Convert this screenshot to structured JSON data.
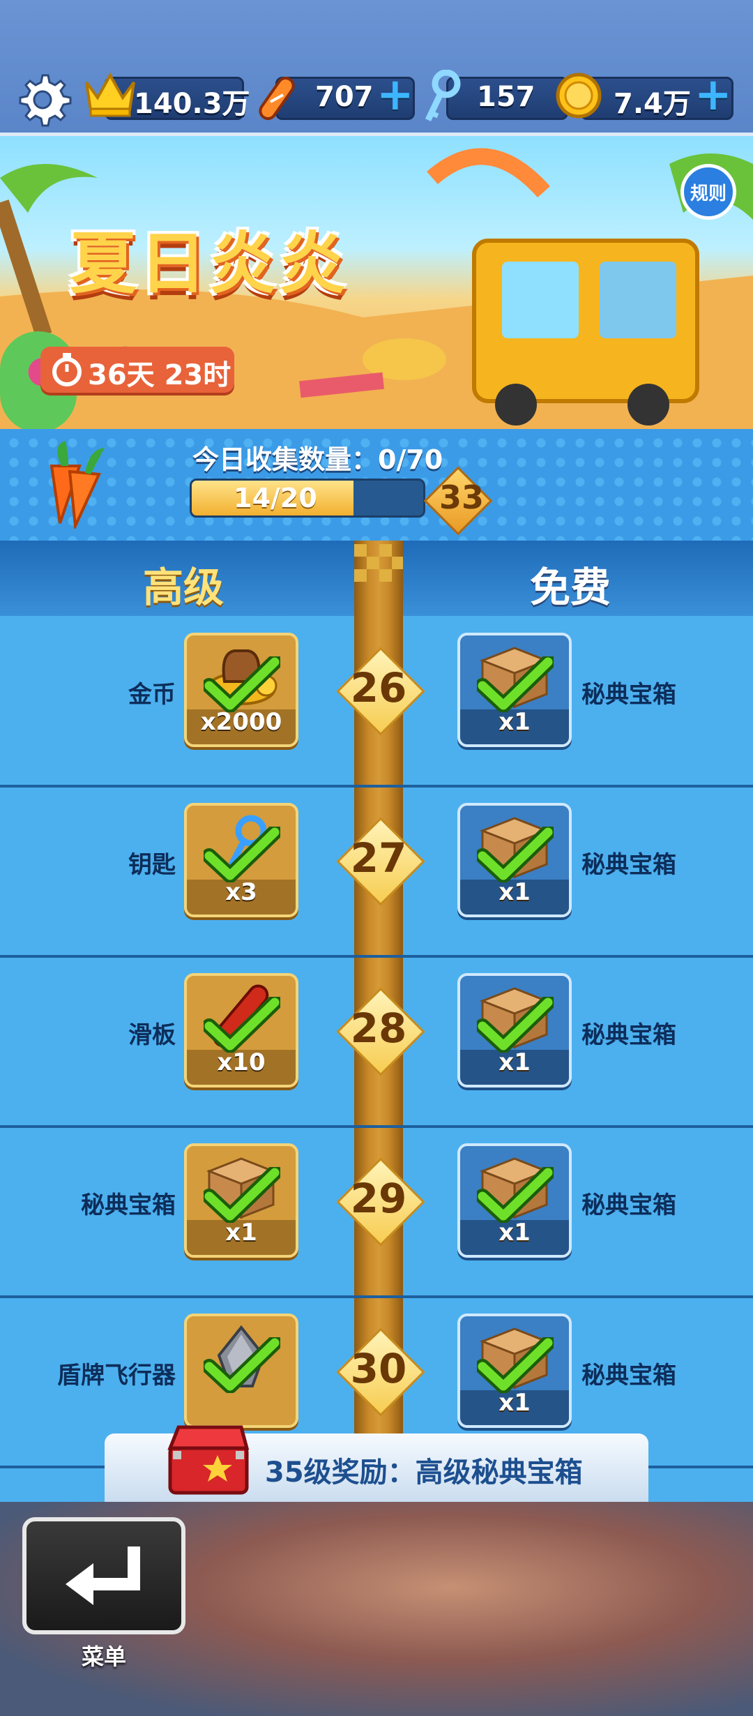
{
  "topbar": {
    "crowns": "140.3万",
    "boards": "707",
    "keys": "157",
    "coins": "7.4万",
    "plus": "+",
    "icons": [
      "gear-icon",
      "crown-icon",
      "skateboard-icon",
      "key-icon",
      "coin-icon"
    ]
  },
  "banner": {
    "title": "夏日炎炎",
    "timer": "36天 23时",
    "rules": "规则"
  },
  "progress": {
    "collect_label": "今日收集数量：0/70",
    "bar_text": "14/20",
    "bar_fraction": 0.7,
    "level": "33"
  },
  "headers": {
    "premium": "高级",
    "free": "免费"
  },
  "rows": [
    {
      "level": "26",
      "premium_name": "金币",
      "premium_qty": "x2000",
      "premium_icon": "coin-bag-icon",
      "free_name": "秘典宝箱",
      "free_qty": "x1",
      "free_icon": "mystery-box-icon"
    },
    {
      "level": "27",
      "premium_name": "钥匙",
      "premium_qty": "x3",
      "premium_icon": "key-icon",
      "free_name": "秘典宝箱",
      "free_qty": "x1",
      "free_icon": "mystery-box-icon"
    },
    {
      "level": "28",
      "premium_name": "滑板",
      "premium_qty": "x10",
      "premium_icon": "skateboard-icon",
      "free_name": "秘典宝箱",
      "free_qty": "x1",
      "free_icon": "mystery-box-icon"
    },
    {
      "level": "29",
      "premium_name": "秘典宝箱",
      "premium_qty": "x1",
      "premium_icon": "mystery-box-icon",
      "free_name": "秘典宝箱",
      "free_qty": "x1",
      "free_icon": "mystery-box-icon"
    },
    {
      "level": "30",
      "premium_name": "盾牌飞行器",
      "premium_qty": "",
      "premium_icon": "shield-glider-icon",
      "free_name": "秘典宝箱",
      "free_qty": "x1",
      "free_icon": "mystery-box-icon"
    }
  ],
  "reward": {
    "text": "35级奖励：高级秘典宝箱"
  },
  "menu": {
    "label": "菜单"
  }
}
